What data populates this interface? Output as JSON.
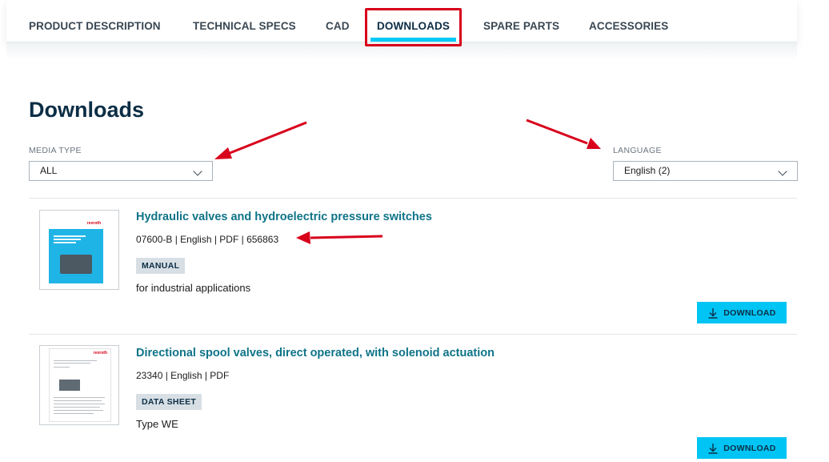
{
  "tabs": [
    {
      "label": "PRODUCT DESCRIPTION",
      "active": false
    },
    {
      "label": "TECHNICAL SPECS",
      "active": false
    },
    {
      "label": "CAD",
      "active": false
    },
    {
      "label": "DOWNLOADS",
      "active": true
    },
    {
      "label": "SPARE PARTS",
      "active": false
    },
    {
      "label": "ACCESSORIES",
      "active": false
    }
  ],
  "page": {
    "title": "Downloads"
  },
  "filters": {
    "media_type": {
      "label": "MEDIA TYPE",
      "value": "ALL"
    },
    "language": {
      "label": "LANGUAGE",
      "value": "English (2)"
    }
  },
  "downloads": [
    {
      "title": "Hydraulic valves and hydroelectric pressure switches",
      "meta": "07600-B | English | PDF | 656863",
      "badge": "MANUAL",
      "description": "for industrial applications",
      "button_label": "DOWNLOAD"
    },
    {
      "title": "Directional spool valves, direct operated, with solenoid actuation",
      "meta": "23340 | English | PDF",
      "badge": "DATA SHEET",
      "description": "Type WE",
      "button_label": "DOWNLOAD"
    }
  ],
  "colors": {
    "accent": "#00c4f4",
    "title_link": "#0f7488",
    "heading": "#0c2e45",
    "annotation_red": "#d8001b"
  }
}
